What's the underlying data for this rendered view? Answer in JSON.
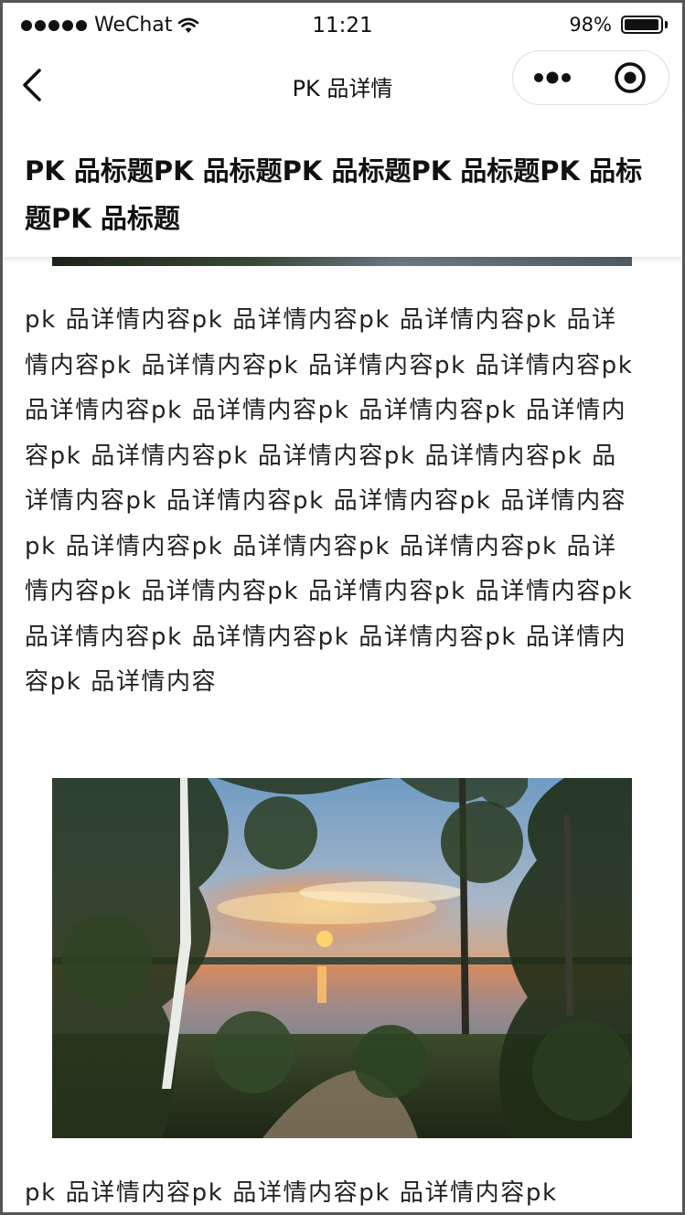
{
  "status_bar": {
    "carrier": "WeChat",
    "time": "11:21",
    "battery": "98%",
    "battery_level": 0.98
  },
  "nav": {
    "title": "PK 品详情",
    "back_icon": "chevron-left-icon",
    "more_icon": "more-dots-icon",
    "close_icon": "target-close-icon"
  },
  "product": {
    "title": "PK 品标题PK 品标题PK 品标题PK 品标题PK 品标题PK 品标题"
  },
  "details": {
    "paragraph_1": "pk 品详情内容pk 品详情内容pk 品详情内容pk 品详情内容pk 品详情内容pk 品详情内容pk 品详情内容pk 品详情内容pk 品详情内容pk 品详情内容pk 品详情内容pk 品详情内容pk 品详情内容pk 品详情内容pk 品详情内容pk 品详情内容pk 品详情内容pk 品详情内容pk 品详情内容pk 品详情内容pk 品详情内容pk 品详情内容pk 品详情内容pk 品详情内容pk 品详情内容pk 品详情内容pk 品详情内容pk 品详情内容pk 品详情内容pk 品详情内容",
    "paragraph_2": "pk 品详情内容pk 品详情内容pk 品详情内容pk",
    "image_subject": "sunset-over-lake-through-trees"
  },
  "colors": {
    "text": "#111111",
    "background": "#ffffff",
    "frame": "#555555"
  }
}
